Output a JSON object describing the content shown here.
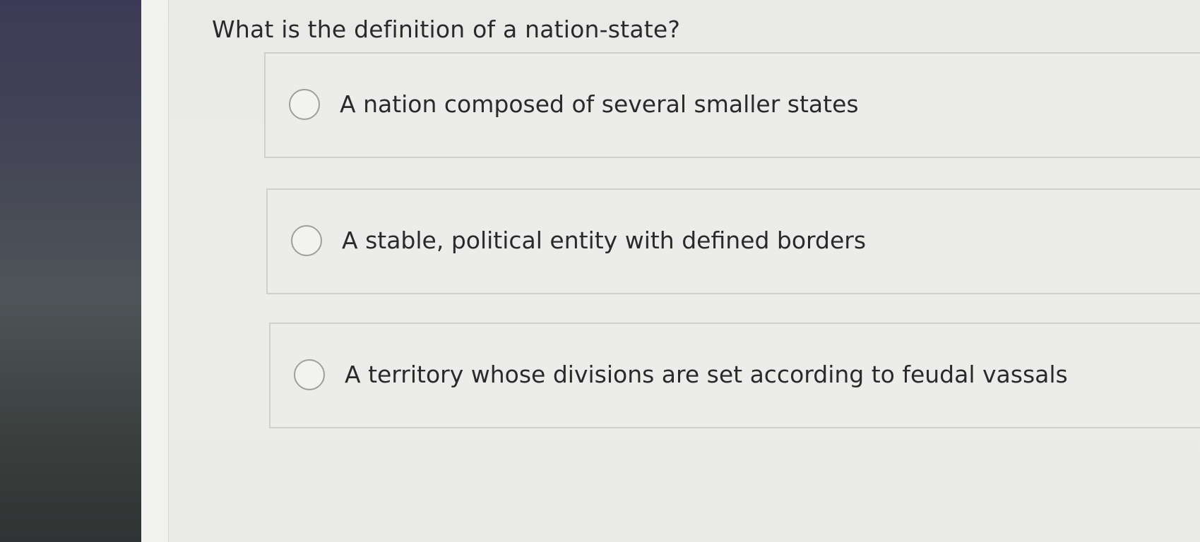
{
  "question": {
    "text": "What is the definition of a nation-state?"
  },
  "options": [
    {
      "label": "A nation composed of several smaller states",
      "selected": false
    },
    {
      "label": "A stable, political entity with defined borders",
      "selected": false
    },
    {
      "label": "A territory whose divisions are set according to feudal vassals",
      "selected": false
    }
  ],
  "colors": {
    "background": "#ececea",
    "option_border": "#cfcfcc",
    "text": "#2a2a2a",
    "radio_border": "#9e9e9c"
  },
  "icons": {
    "radio": "radio-unchecked-icon"
  }
}
